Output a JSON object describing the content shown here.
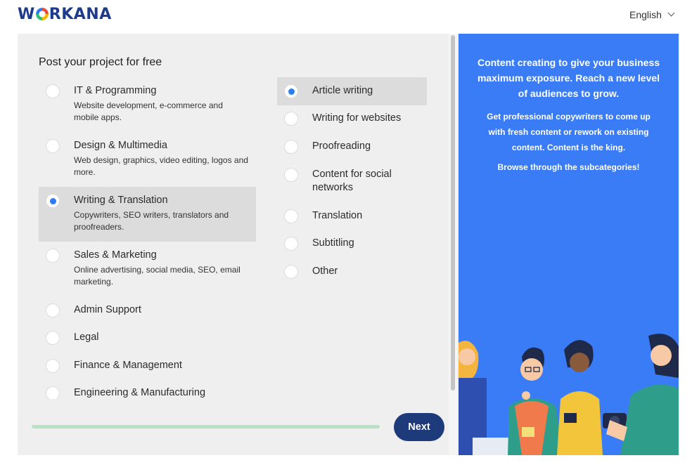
{
  "header": {
    "logo_text_pre": "W",
    "logo_text_post": "RKANA",
    "language": "English"
  },
  "form": {
    "title": "Post your project for free",
    "categories": [
      {
        "label": "IT & Programming",
        "desc": "Website development, e-commerce and mobile apps.",
        "selected": false
      },
      {
        "label": "Design & Multimedia",
        "desc": "Web design, graphics, video editing, logos and more.",
        "selected": false
      },
      {
        "label": "Writing & Translation",
        "desc": "Copywriters, SEO writers, translators and proofreaders.",
        "selected": true
      },
      {
        "label": "Sales & Marketing",
        "desc": "Online advertising, social media, SEO, email marketing.",
        "selected": false
      },
      {
        "label": "Admin Support",
        "desc": "",
        "selected": false
      },
      {
        "label": "Legal",
        "desc": "",
        "selected": false
      },
      {
        "label": "Finance & Management",
        "desc": "",
        "selected": false
      },
      {
        "label": "Engineering & Manufacturing",
        "desc": "",
        "selected": false
      }
    ],
    "subcategories": [
      {
        "label": "Article writing",
        "selected": true
      },
      {
        "label": "Writing for websites",
        "selected": false
      },
      {
        "label": "Proofreading",
        "selected": false
      },
      {
        "label": "Content for social networks",
        "selected": false
      },
      {
        "label": "Translation",
        "selected": false
      },
      {
        "label": "Subtitling",
        "selected": false
      },
      {
        "label": "Other",
        "selected": false
      }
    ],
    "next_label": "Next"
  },
  "promo": {
    "headline": "Content creating to give your business maximum exposure. Reach a new level of audiences to grow.",
    "body": "Get professional copywriters to come up with fresh content or rework on existing content. Content is the king.",
    "cta": "Browse through the subcategories!"
  },
  "colors": {
    "brand_navy": "#1d3a8c",
    "accent_blue": "#2a7df4",
    "promo_blue": "#3a7cf5",
    "progress_green": "#b5e3c3",
    "button_navy": "#1d3a7a"
  }
}
